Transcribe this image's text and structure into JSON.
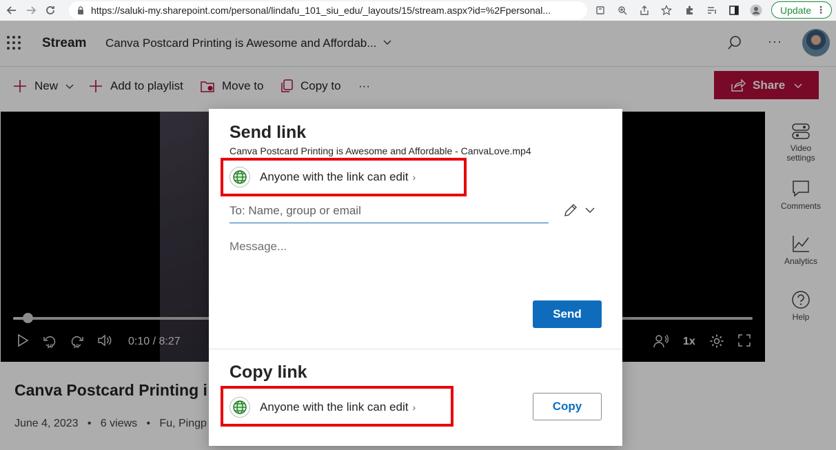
{
  "browser": {
    "url": "https://saluki-my.sharepoint.com/personal/lindafu_101_siu_edu/_layouts/15/stream.aspx?id=%2Fpersonal...",
    "update_label": "Update"
  },
  "header": {
    "app_name": "Stream",
    "document_title": "Canva Postcard Printing is Awesome and Affordab..."
  },
  "commandbar": {
    "new_label": "New",
    "add_to_playlist_label": "Add to playlist",
    "move_to_label": "Move to",
    "copy_to_label": "Copy to",
    "more_label": "···",
    "share_label": "Share"
  },
  "player": {
    "time_display": "0:10 / 8:27",
    "speed": "1x",
    "progress_fraction": 0.02
  },
  "rail": {
    "video_settings_label": "Video settings",
    "comments_label": "Comments",
    "analytics_label": "Analytics",
    "help_label": "Help"
  },
  "video_info": {
    "title": "Canva Postcard Printing i",
    "meta": "June 4, 2023   •   6 views   •   Fu, Pingp"
  },
  "dialog": {
    "send_heading": "Send link",
    "file_name": "Canva Postcard Printing is Awesome and Affordable - CanvaLove.mp4",
    "send_permission": "Anyone with the link can edit",
    "to_placeholder": "To: Name, group or email",
    "message_placeholder": "Message...",
    "send_button": "Send",
    "copy_heading": "Copy link",
    "copy_permission": "Anyone with the link can edit",
    "copy_button": "Copy"
  },
  "colors": {
    "accent_blue": "#0f6cbd",
    "share_red": "#b10e3a",
    "highlight_red": "#e8000b",
    "globe_green": "#107c10"
  }
}
